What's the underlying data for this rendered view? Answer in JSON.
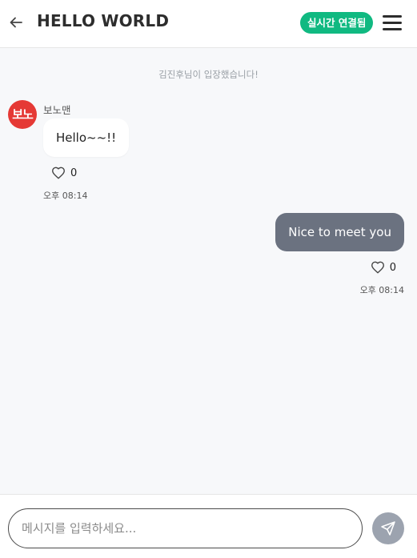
{
  "header": {
    "back_icon": "arrow-left-icon",
    "title": "HELLO WORLD",
    "status": "실시간 연결됨",
    "menu_icon": "hamburger-menu-icon"
  },
  "messages": {
    "system": "김진후님이 입장했습니다!",
    "incoming": {
      "avatar_text": "보노",
      "sender": "보노맨",
      "text": "Hello~~!!",
      "likes": "0",
      "time": "오후 08:14"
    },
    "outgoing": {
      "text": "Nice to meet you",
      "likes": "0",
      "time": "오후 08:14"
    }
  },
  "composer": {
    "placeholder": "메시지를 입력하세요...",
    "value": "",
    "send_icon": "paper-plane-icon"
  },
  "colors": {
    "accent": "#10b981",
    "avatar_bg": "#e53935",
    "outgoing_bubble": "#6b7280",
    "send_button": "#9ca3af"
  }
}
